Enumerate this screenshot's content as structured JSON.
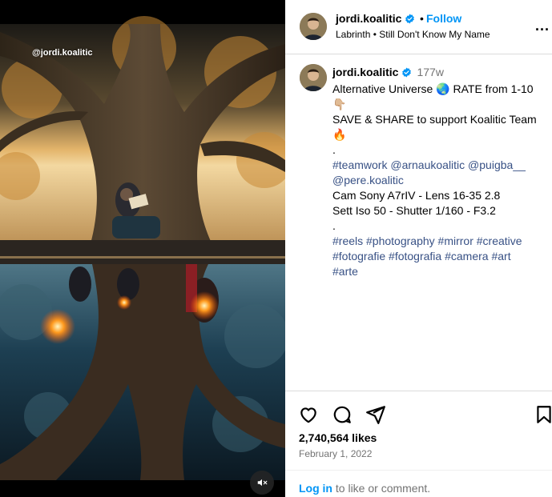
{
  "media": {
    "watermark": "@jordi.koalitic"
  },
  "header": {
    "username": "jordi.koalitic",
    "separator": "•",
    "follow_label": "Follow",
    "song_artist": "Labrinth",
    "song_title": "Still Don't Know My Name",
    "more_label": "..."
  },
  "caption": {
    "username": "jordi.koalitic",
    "time": "177w",
    "line1": "Alternative Universe 🌏 RATE from 1-10",
    "line1_emoji": "👇🏼",
    "line2": "SAVE & SHARE to support Koalitic Team",
    "line2_emoji": "🔥",
    "dot1": ".",
    "tags1": "#teamwork @arnaukoalitic @puigba__",
    "tags1b": "@pere.koalitic",
    "line3": "Cam Sony A7rIV - Lens 16-35 2.8",
    "line4": "Sett Iso 50 - Shutter 1/160 - F3.2",
    "dot2": ".",
    "tags2": "#reels #photography #mirror #creative",
    "tags2b": "#fotografie #fotografia #camera #art",
    "tags2c": "#arte"
  },
  "actions": {
    "likes": "2,740,564 likes",
    "date": "February 1, 2022",
    "login_link": "Log in",
    "login_suffix": " to like or comment."
  },
  "colors": {
    "accent": "#0095f6",
    "link": "#385185",
    "muted": "#737373",
    "border": "#dbdbdb"
  }
}
